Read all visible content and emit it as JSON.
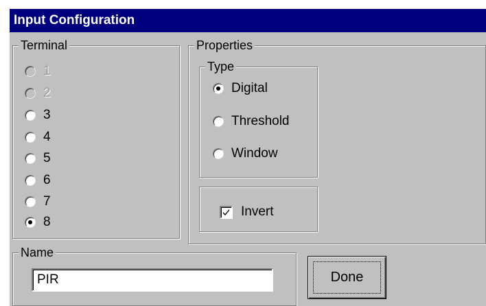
{
  "window": {
    "title": "Input Configuration"
  },
  "terminal": {
    "legend": "Terminal",
    "options": [
      {
        "label": "1",
        "checked": false,
        "enabled": false
      },
      {
        "label": "2",
        "checked": false,
        "enabled": false
      },
      {
        "label": "3",
        "checked": false,
        "enabled": true
      },
      {
        "label": "4",
        "checked": false,
        "enabled": true
      },
      {
        "label": "5",
        "checked": false,
        "enabled": true
      },
      {
        "label": "6",
        "checked": false,
        "enabled": true
      },
      {
        "label": "7",
        "checked": false,
        "enabled": true
      },
      {
        "label": "8",
        "checked": true,
        "enabled": true
      }
    ]
  },
  "properties": {
    "legend": "Properties",
    "type": {
      "legend": "Type",
      "options": [
        {
          "label": "Digital",
          "checked": true
        },
        {
          "label": "Threshold",
          "checked": false
        },
        {
          "label": "Window",
          "checked": false
        }
      ]
    },
    "invert": {
      "label": "Invert",
      "checked": true
    }
  },
  "name": {
    "legend": "Name",
    "value": "PIR"
  },
  "done": {
    "label": "Done"
  },
  "colors": {
    "titlebar": "#00007f",
    "face": "#c0c0c0"
  }
}
